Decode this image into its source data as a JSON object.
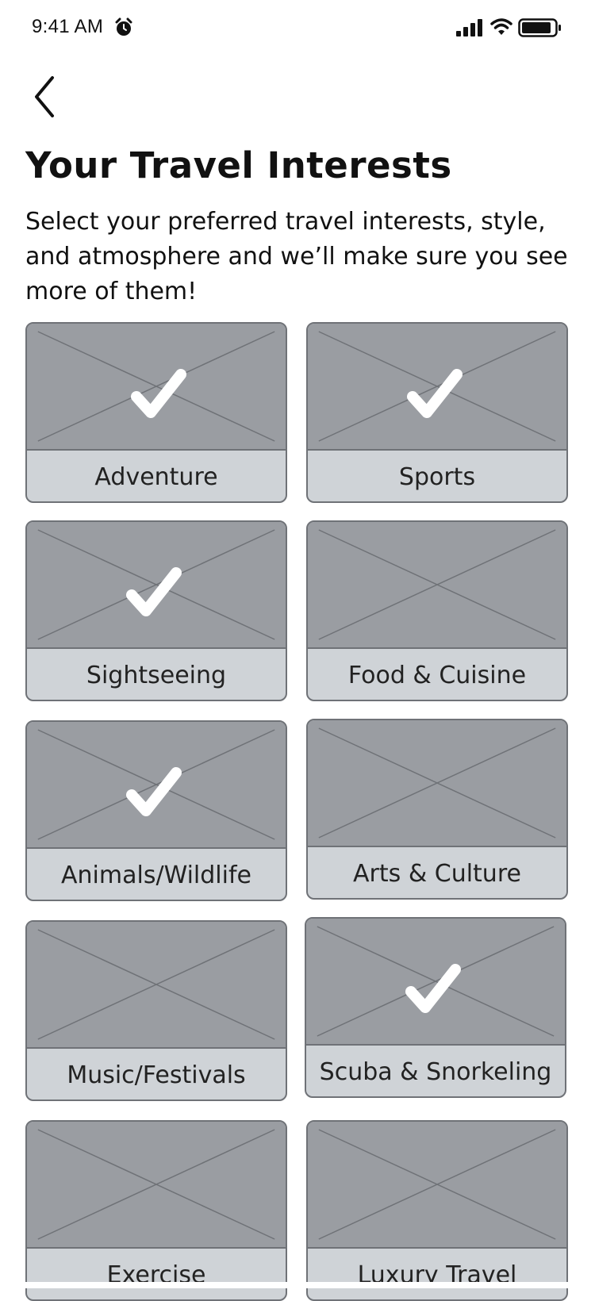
{
  "status_bar": {
    "time": "9:41 AM",
    "icons": [
      "alarm-icon",
      "signal-icon",
      "wifi-icon",
      "battery-icon"
    ]
  },
  "header": {
    "back_icon": "chevron-left-icon",
    "title": "Your Travel Interests",
    "subtitle": "Select your preferred travel interests, style, and atmosphere and we’ll make sure you see more of them!"
  },
  "interests": [
    {
      "label": "Adventure",
      "selected": true
    },
    {
      "label": "Sports",
      "selected": true
    },
    {
      "label": "Sightseeing",
      "selected": true
    },
    {
      "label": "Food & Cuisine",
      "selected": false
    },
    {
      "label": "Animals/Wildlife",
      "selected": true
    },
    {
      "label": "Arts & Culture",
      "selected": false
    },
    {
      "label": "Music/Festivals",
      "selected": false
    },
    {
      "label": "Scuba & Snorkeling",
      "selected": true
    },
    {
      "label": "Exercise",
      "selected": false
    },
    {
      "label": "Luxury Travel",
      "selected": false
    }
  ],
  "colors": {
    "image_placeholder": "#9a9da2",
    "label_background": "#cfd3d7",
    "border": "#6f7277",
    "check": "#ffffff"
  }
}
